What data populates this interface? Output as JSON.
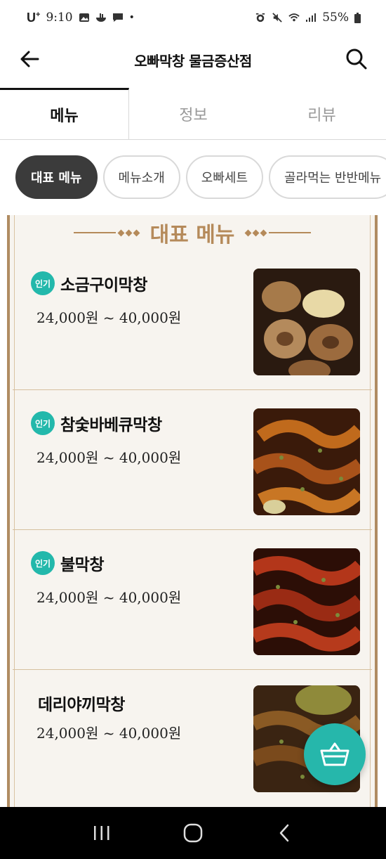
{
  "status_bar": {
    "carrier": "U",
    "carrier_sup": "+",
    "time": "9:10",
    "dot": "•",
    "battery": "55%"
  },
  "header": {
    "title": "오빠막창 물금증산점"
  },
  "tabs": [
    {
      "label": "메뉴",
      "active": true
    },
    {
      "label": "정보",
      "active": false
    },
    {
      "label": "리뷰",
      "active": false
    }
  ],
  "chips": [
    {
      "label": "대표 메뉴",
      "active": true
    },
    {
      "label": "메뉴소개",
      "active": false
    },
    {
      "label": "오빠세트",
      "active": false
    },
    {
      "label": "골라먹는 반반메뉴",
      "active": false
    }
  ],
  "board": {
    "title": "대표 메뉴"
  },
  "menu_items": [
    {
      "badge": "인기",
      "name": "소금구이막창",
      "price": "24,000원 ~ 40,000원"
    },
    {
      "badge": "인기",
      "name": "참숯바베큐막창",
      "price": "24,000원 ~ 40,000원"
    },
    {
      "badge": "인기",
      "name": "불막창",
      "price": "24,000원 ~ 40,000원"
    },
    {
      "badge": "",
      "name": "데리야끼막창",
      "price": "24,000원 ~ 40,000원"
    }
  ],
  "colors": {
    "accent": "#26b7ab",
    "board_border": "#b08c62",
    "board_title": "#b58a5a"
  }
}
